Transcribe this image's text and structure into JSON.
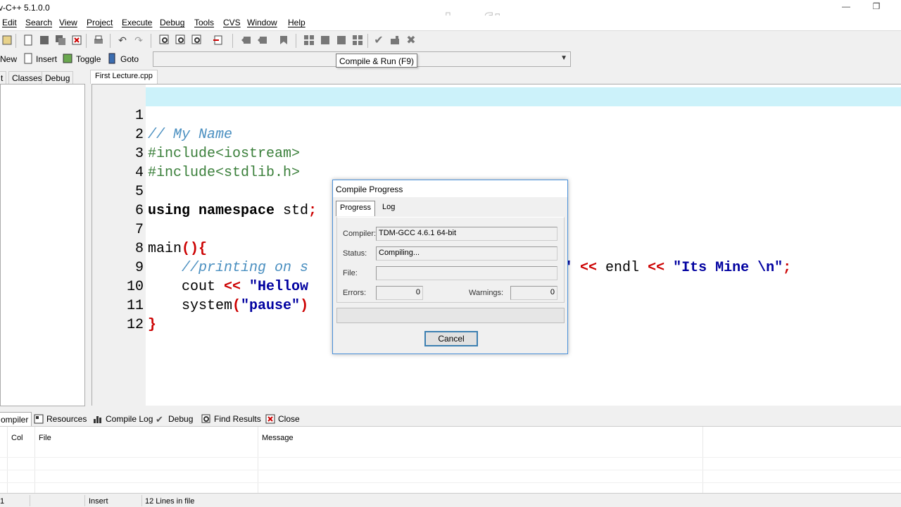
{
  "window": {
    "title": "v-C++ 5.1.0.0",
    "watermark": "www.zdsoft.com"
  },
  "menu": [
    "Edit",
    "Search",
    "View",
    "Project",
    "Execute",
    "Debug",
    "Tools",
    "CVS",
    "Window",
    "Help"
  ],
  "toolbar2": {
    "new_label": "New",
    "insert_label": "Insert",
    "toggle_label": "Toggle",
    "goto_label": "Goto"
  },
  "tooltip": "Compile & Run (F9)",
  "left_tabs": [
    "t",
    "Classes",
    "Debug"
  ],
  "editor": {
    "tab": "First Lecture.cpp",
    "lines": [
      {
        "num": "1"
      },
      {
        "num": "2"
      },
      {
        "num": "3"
      },
      {
        "num": "4"
      },
      {
        "num": "5"
      },
      {
        "num": "6"
      },
      {
        "num": "7"
      },
      {
        "num": "8"
      },
      {
        "num": "9"
      },
      {
        "num": "10"
      },
      {
        "num": "11"
      },
      {
        "num": "12"
      }
    ],
    "code": {
      "l1": "// My Name",
      "l2": "#include<iostream>",
      "l3": "#include<stdlib.h>",
      "l5_kw": "using namespace",
      "l5_rest": " std",
      "l5_semi": ";",
      "l7_main": "main",
      "l7_parens": "(){",
      "l8_comment": "    //printing on s",
      "l9_cout": "    cout ",
      "l9_op1": "<<",
      "l9_str1": " \"Hellow",
      "l9_frag": "r\" ",
      "l9_op2": "<<",
      "l9_endl": " endl ",
      "l9_op3": "<<",
      "l9_str2": " \"Its Mine \\n\"",
      "l9_semi": ";",
      "l10_sys": "    system",
      "l10_p1": "(",
      "l10_str": "\"pause\"",
      "l10_p2": ")",
      "l11": "}"
    }
  },
  "dialog": {
    "title": "Compile Progress",
    "tabs": [
      "Progress",
      "Log"
    ],
    "compiler_label": "Compiler:",
    "compiler_value": "TDM-GCC 4.6.1 64-bit",
    "status_label": "Status:",
    "status_value": "Compiling...",
    "file_label": "File:",
    "file_value": "",
    "errors_label": "Errors:",
    "errors_value": "0",
    "warnings_label": "Warnings:",
    "warnings_value": "0",
    "cancel_label": "Cancel"
  },
  "bottom_tabs": [
    "ompiler",
    "Resources",
    "Compile Log",
    "Debug",
    "Find Results",
    "Close"
  ],
  "messages": {
    "columns": [
      "Col",
      "File",
      "Message"
    ]
  },
  "status_bar": {
    "line": "1",
    "mode": "Insert",
    "info": "12 Lines in file"
  }
}
